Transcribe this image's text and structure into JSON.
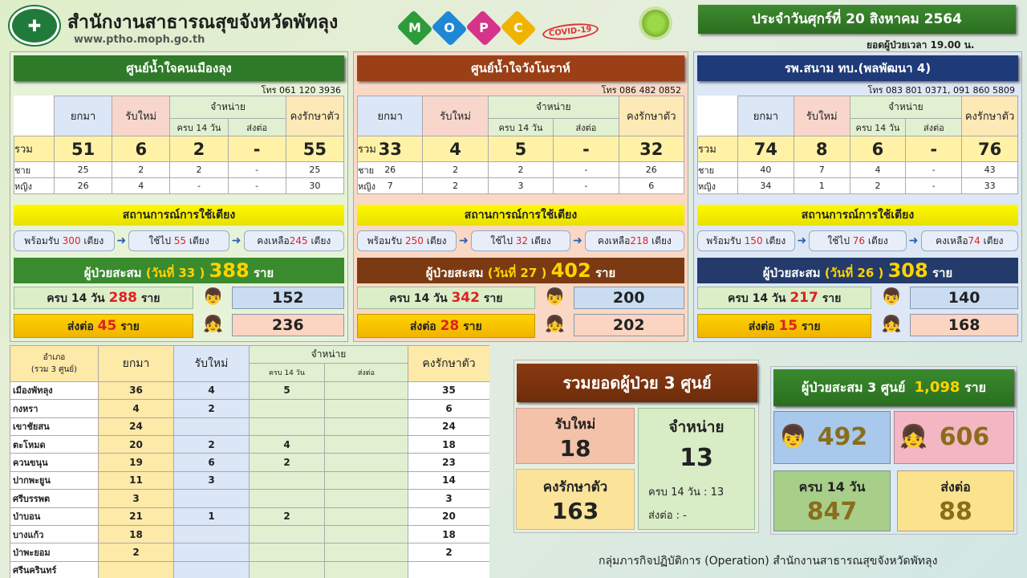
{
  "header": {
    "org_name": "สำนักงานสาธารณสุขจังหวัดพัทลุง",
    "url": "www.ptho.moph.go.th",
    "mopc": [
      "M",
      "O",
      "P",
      "C"
    ],
    "covid_stamp": "COVID-19",
    "date": "ประจำวันศุกร์ที่ 20 สิงหาคม 2564",
    "time_line": "ยอดผู้ป่วยเวลา 19.00 น."
  },
  "labels": {
    "carry": "ยกมา",
    "new": "รับใหม่",
    "discharge": "จำหน่าย",
    "full14": "ครบ 14 วัน",
    "refer": "ส่งต่อ",
    "remain": "คงรักษาตัว",
    "total": "รวม",
    "male": "ชาย",
    "female": "หญิง",
    "bed_title": "สถานการณ์การใช้เตียง",
    "cum_prefix": "ผู้ป่วยสะสม",
    "unit": "ราย"
  },
  "centers": [
    {
      "title": "ศูนย์น้ำใจคนเมืองลุง",
      "phone": "โทร 061 120 3936",
      "total": [
        "51",
        "6",
        "2",
        "-",
        "55"
      ],
      "male": [
        "25",
        "2",
        "2",
        "-",
        "25"
      ],
      "female": [
        "26",
        "4",
        "-",
        "-",
        "30"
      ],
      "bed_ready": "พร้อมรับ",
      "bed_ready_n": "300",
      "bed_used": "ใช้ไป",
      "bed_used_n": "55",
      "bed_left": "คงเหลือ",
      "bed_left_n": "245",
      "bed_unit": "เตียง",
      "cum_day": "(วันที่ 33 )",
      "cum_total": "388",
      "full14_n": "288",
      "refer_n": "45",
      "male_cum": "152",
      "female_cum": "236",
      "colors": {
        "bg": "#e7f3d8",
        "title": "#2f7a28",
        "acc": "#3a8a2e"
      }
    },
    {
      "title": "ศูนย์น้ำใจวังโนราห์",
      "phone": "โทร 086 482 0852",
      "total": [
        "33",
        "4",
        "5",
        "-",
        "32"
      ],
      "male": [
        "26",
        "2",
        "2",
        "-",
        "26"
      ],
      "female": [
        "7",
        "2",
        "3",
        "-",
        "6"
      ],
      "bed_ready": "พร้อมรับ",
      "bed_ready_n": "250",
      "bed_used": "ใช้ไป",
      "bed_used_n": "32",
      "bed_left": "คงเหลือ",
      "bed_left_n": "218",
      "bed_unit": "เตียง",
      "cum_day": "(วันที่ 27 )",
      "cum_total": "402",
      "full14_n": "342",
      "refer_n": "28",
      "male_cum": "200",
      "female_cum": "202",
      "colors": {
        "bg": "#f9d8c6",
        "title": "#9b3f16",
        "acc": "#7b3a12"
      }
    },
    {
      "title": "รพ.สนาม ทบ.(พลพัฒนา 4)",
      "phone": "โทร 083 801 0371, 091 860 5809",
      "total": [
        "74",
        "8",
        "6",
        "-",
        "76"
      ],
      "male": [
        "40",
        "7",
        "4",
        "-",
        "43"
      ],
      "female": [
        "34",
        "1",
        "2",
        "-",
        "33"
      ],
      "bed_ready": "พร้อมรับ",
      "bed_ready_n": "150",
      "bed_used": "ใช้ไป",
      "bed_used_n": "76",
      "bed_left": "คงเหลือ",
      "bed_left_n": "74",
      "bed_unit": "เตียง",
      "cum_day": "(วันที่ 26 )",
      "cum_total": "308",
      "full14_n": "217",
      "refer_n": "15",
      "male_cum": "140",
      "female_cum": "168",
      "colors": {
        "bg": "#dde7f5",
        "title": "#1e3a78",
        "acc": "#233a6b"
      }
    }
  ],
  "district_table": {
    "h_district": "อำเภอ",
    "h_sub": "(รวม 3 ศูนย์)",
    "rows": [
      [
        "เมืองพัทลุง",
        "36",
        "4",
        "5",
        "",
        "35"
      ],
      [
        "กงหรา",
        "4",
        "2",
        "",
        "",
        "6"
      ],
      [
        "เขาชัยสน",
        "24",
        "",
        "",
        "",
        "24"
      ],
      [
        "ตะโหมด",
        "20",
        "2",
        "4",
        "",
        "18"
      ],
      [
        "ควนขนุน",
        "19",
        "6",
        "2",
        "",
        "23"
      ],
      [
        "ปากพะยูน",
        "11",
        "3",
        "",
        "",
        "14"
      ],
      [
        "ศรีบรรพต",
        "3",
        "",
        "",
        "",
        "3"
      ],
      [
        "ป่าบอน",
        "21",
        "1",
        "2",
        "",
        "20"
      ],
      [
        "บางแก้ว",
        "18",
        "",
        "",
        "",
        "18"
      ],
      [
        "ป่าพะยอม",
        "2",
        "",
        "",
        "",
        "2"
      ],
      [
        "ศรีนครินทร์",
        "",
        "",
        "",
        "",
        ""
      ]
    ]
  },
  "summary": {
    "title": "รวมยอดผู้ป่วย 3 ศูนย์",
    "new_label": "รับใหม่",
    "new_val": "18",
    "dis_label": "จำหน่าย",
    "dis_val": "13",
    "remain_label": "คงรักษาตัว",
    "remain_val": "163",
    "dis_full14": "ครบ 14 วัน  : 13",
    "dis_refer": "ส่งต่อ : -"
  },
  "cumulative": {
    "title_prefix": "ผู้ป่วยสะสม 3 ศูนย์",
    "total": "1,098",
    "unit": "ราย",
    "male": "492",
    "female": "606",
    "full14_label": "ครบ 14 วัน",
    "full14": "847",
    "refer_label": "ส่งต่อ",
    "refer": "88"
  },
  "footer": "กลุ่มภารกิจปฏิบัติการ (Operation) สำนักงานสาธารณสุขจังหวัดพัทลุง"
}
